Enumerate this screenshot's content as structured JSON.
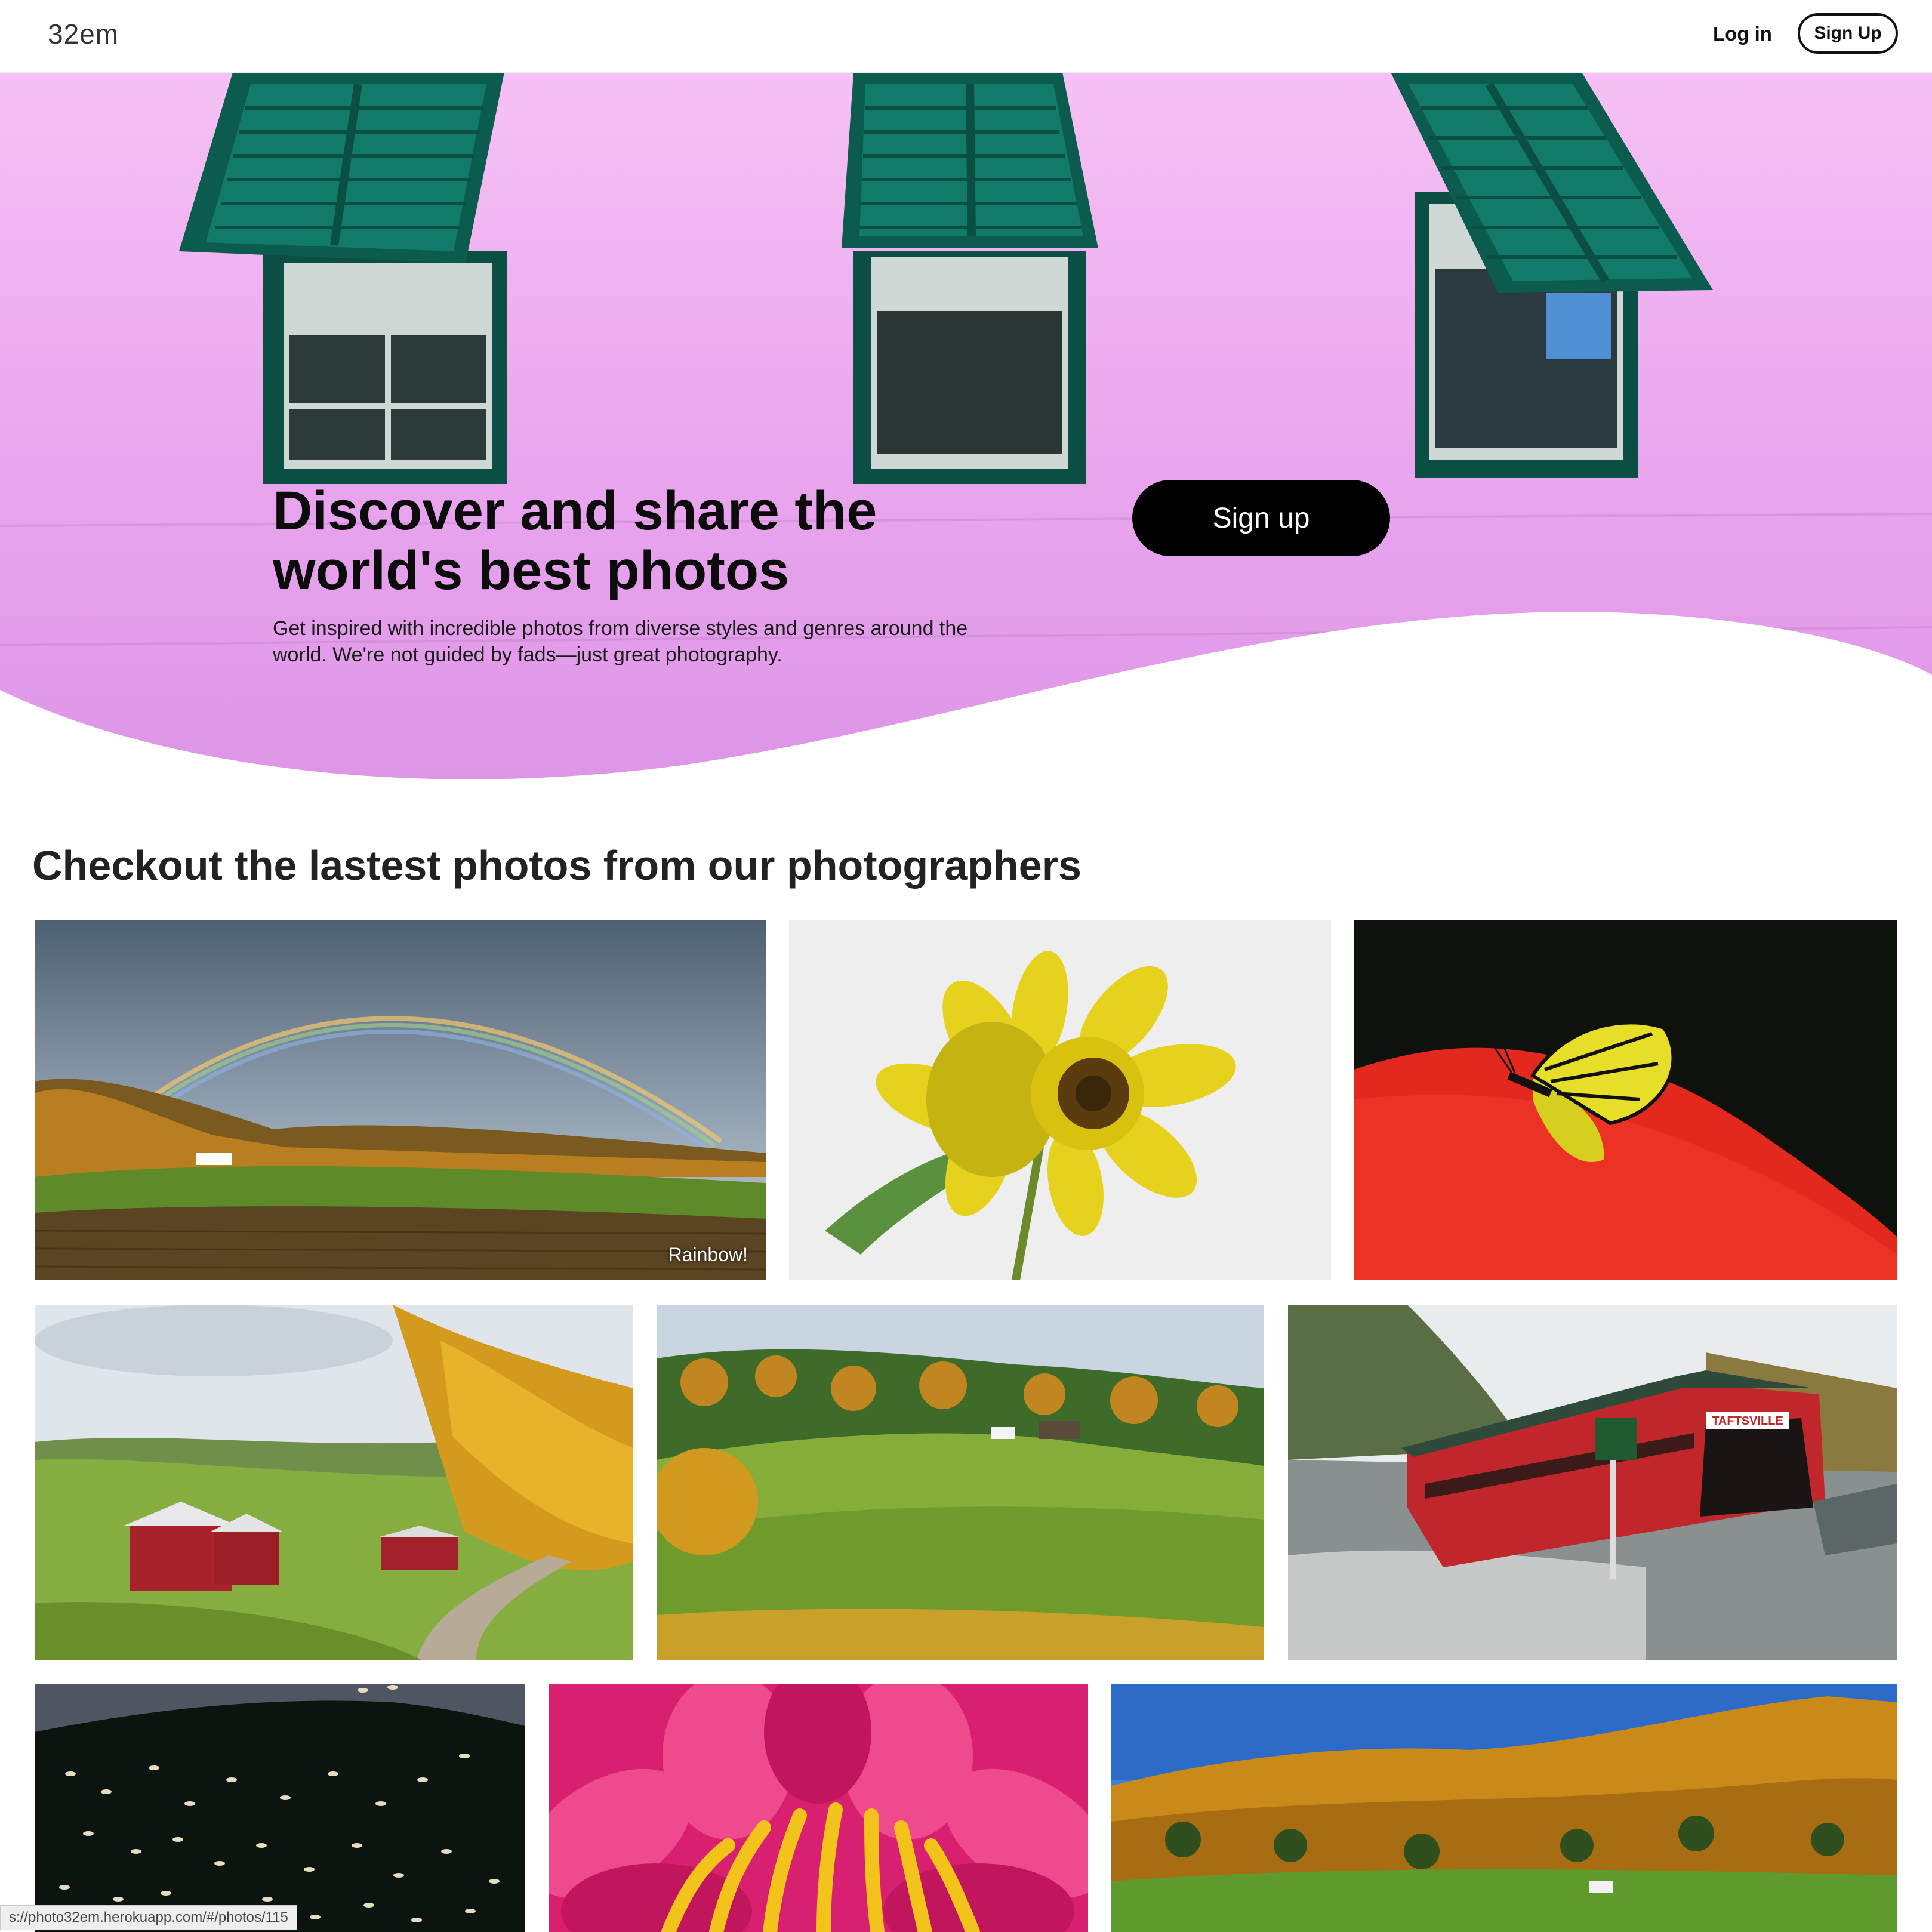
{
  "header": {
    "logo": "32em",
    "login_label": "Log in",
    "signup_label": "Sign Up"
  },
  "hero": {
    "title": "Discover and share the world's best photos",
    "subtitle": "Get inspired with incredible photos from diverse styles and genres around the world. We're not guided by fads—just great photography.",
    "signup_label": "Sign up",
    "background_color": "#ecaaf0",
    "shutter_color": "#0b5c4e"
  },
  "gallery": {
    "title": "Checkout the lastest photos from our photographers",
    "photos": [
      {
        "subject": "rainbow over autumn farm field",
        "caption": "Rainbow!"
      },
      {
        "subject": "yellow sunflower on white background"
      },
      {
        "subject": "yellow butterfly on red fabric"
      },
      {
        "subject": "red barns on autumn country road"
      },
      {
        "subject": "green rolling hills with autumn forest"
      },
      {
        "subject": "red covered bridge",
        "sign": "TAFTSVILLE"
      },
      {
        "subject": "flock of snow geese over dark hill"
      },
      {
        "subject": "pink water lily close-up"
      },
      {
        "subject": "autumn forest hillside under blue sky"
      }
    ]
  },
  "statusbar": {
    "url": "s://photo32em.herokuapp.com/#/photos/115"
  }
}
